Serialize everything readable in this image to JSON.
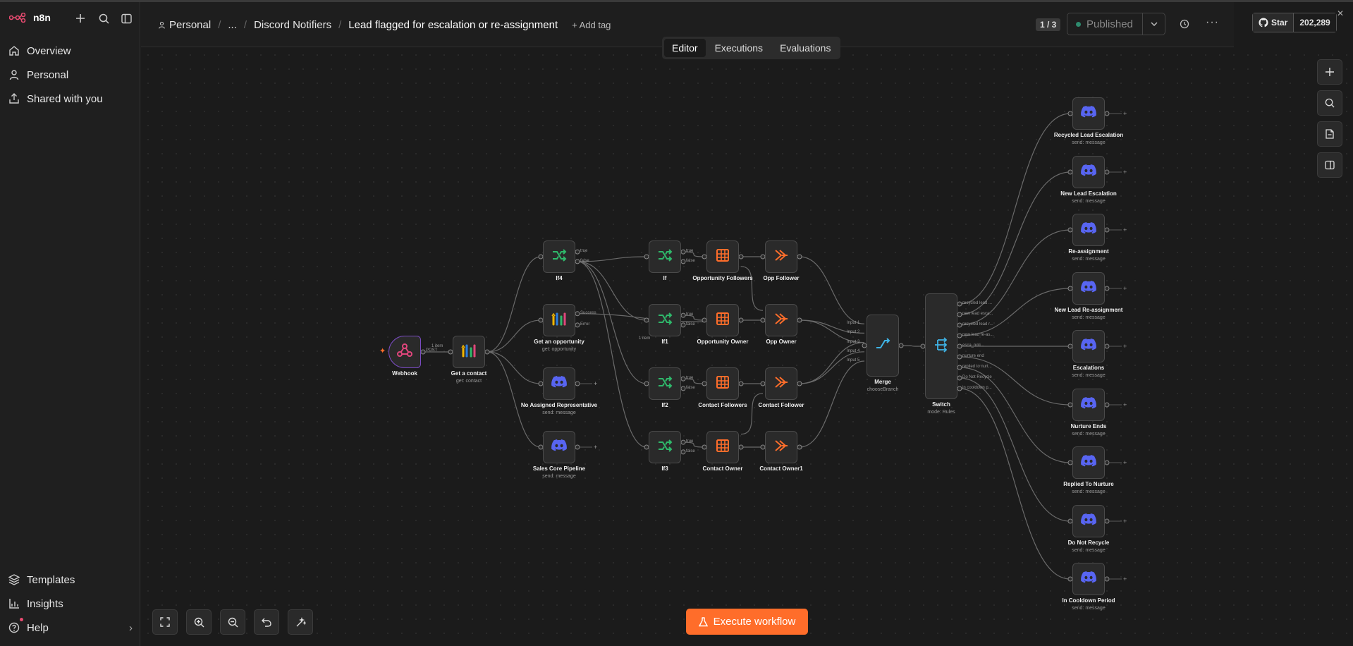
{
  "app": {
    "name": "n8n"
  },
  "sidebar": {
    "nav": [
      {
        "label": "Overview"
      },
      {
        "label": "Personal"
      },
      {
        "label": "Shared with you"
      }
    ],
    "bottom": [
      {
        "label": "Templates"
      },
      {
        "label": "Insights"
      },
      {
        "label": "Help"
      }
    ]
  },
  "header": {
    "breadcrumb": [
      "Personal",
      "...",
      "Discord Notifiers",
      "Lead flagged for escalation or re-assignment"
    ],
    "add_tag": "+ Add tag",
    "counter": "1 / 3",
    "status": "Published",
    "github": {
      "star_label": "Star",
      "count": "202,289"
    }
  },
  "tabs": [
    "Editor",
    "Executions",
    "Evaluations"
  ],
  "active_tab": "Editor",
  "execute_button": "Execute workflow",
  "nodes": {
    "webhook": {
      "label": "Webhook"
    },
    "get_contact": {
      "label": "Get a contact",
      "sub": "get: contact"
    },
    "if4": {
      "label": "If4"
    },
    "get_opportunity": {
      "label": "Get an opportunity",
      "sub": "get: opportunity"
    },
    "no_assigned": {
      "label": "No Assigned Representative",
      "sub": "send: message"
    },
    "sales_core": {
      "label": "Sales Core Pipeline",
      "sub": "send: message"
    },
    "if": {
      "label": "If"
    },
    "if1": {
      "label": "If1"
    },
    "if2": {
      "label": "If2"
    },
    "if3": {
      "label": "If3"
    },
    "opp_followers": {
      "label": "Opportunity Followers"
    },
    "opp_owner": {
      "label": "Opportunity Owner"
    },
    "contact_followers": {
      "label": "Contact Followers"
    },
    "contact_owner": {
      "label": "Contact Owner"
    },
    "opp_follower": {
      "label": "Opp Follower"
    },
    "opp_owner2": {
      "label": "Opp Owner"
    },
    "contact_follower": {
      "label": "Contact Follower"
    },
    "contact_owner1": {
      "label": "Contact Owner1"
    },
    "merge": {
      "label": "Merge",
      "sub": "chooseBranch"
    },
    "switch": {
      "label": "Switch",
      "sub": "mode: Rules"
    },
    "recycled": {
      "label": "Recycled Lead Escalation",
      "sub": "send: message"
    },
    "new_lead_esc": {
      "label": "New Lead Escalation",
      "sub": "send: message"
    },
    "reassignment": {
      "label": "Re-assignment",
      "sub": "send: message"
    },
    "new_lead_reassign": {
      "label": "New Lead Re-assignment",
      "sub": "send: message"
    },
    "escalations": {
      "label": "Escalations",
      "sub": "send: message"
    },
    "nurture_ends": {
      "label": "Nurture Ends",
      "sub": "send: message"
    },
    "replied_nurture": {
      "label": "Replied To Nurture",
      "sub": "send: message"
    },
    "do_not_recycle": {
      "label": "Do Not Recycle",
      "sub": "send: message"
    },
    "cooldown": {
      "label": "In Cooldown Period",
      "sub": "send: message"
    }
  },
  "port_labels": {
    "true": "true",
    "false": "false",
    "success": "Success",
    "error": "Error",
    "item": "1 item",
    "post": "POST",
    "inputs": [
      "Input 1",
      "Input 2",
      "Input 3",
      "Input 4",
      "Input 5"
    ],
    "switch_outputs": [
      "recycled lead ...",
      "new lead esca...",
      "recycled lead r...",
      "new lead re-as...",
      "esca_noti...",
      "nurture end",
      "replied to nurt...",
      "Do Not Recycle",
      "in cooldown p..."
    ]
  },
  "colors": {
    "accent": "#ff6d2a",
    "discord": "#5865f2",
    "if_green": "#2fb96b",
    "sheet_orange": "#ff6d2a",
    "merge_blue": "#3fb4e6"
  }
}
